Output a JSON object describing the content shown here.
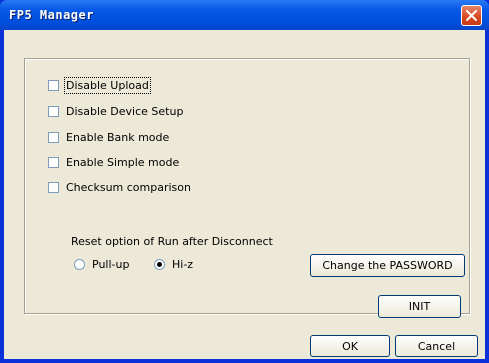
{
  "window": {
    "title": "FP5 Manager"
  },
  "options": [
    {
      "label": "Disable Upload",
      "checked": false
    },
    {
      "label": "Disable Device Setup",
      "checked": false
    },
    {
      "label": "Enable Bank mode",
      "checked": false
    },
    {
      "label": "Enable Simple mode",
      "checked": false
    },
    {
      "label": "Checksum comparison",
      "checked": false
    }
  ],
  "reset": {
    "label": "Reset option of Run after Disconnect",
    "radios": [
      {
        "label": "Pull-up",
        "selected": false
      },
      {
        "label": "Hi-z",
        "selected": true
      }
    ]
  },
  "buttons": {
    "change_password": "Change the PASSWORD",
    "init": "INIT",
    "ok": "OK",
    "cancel": "Cancel"
  },
  "colors": {
    "titlebar": "#0054e3",
    "dialog_face": "#ece9d8",
    "close_button": "#d8461e"
  }
}
